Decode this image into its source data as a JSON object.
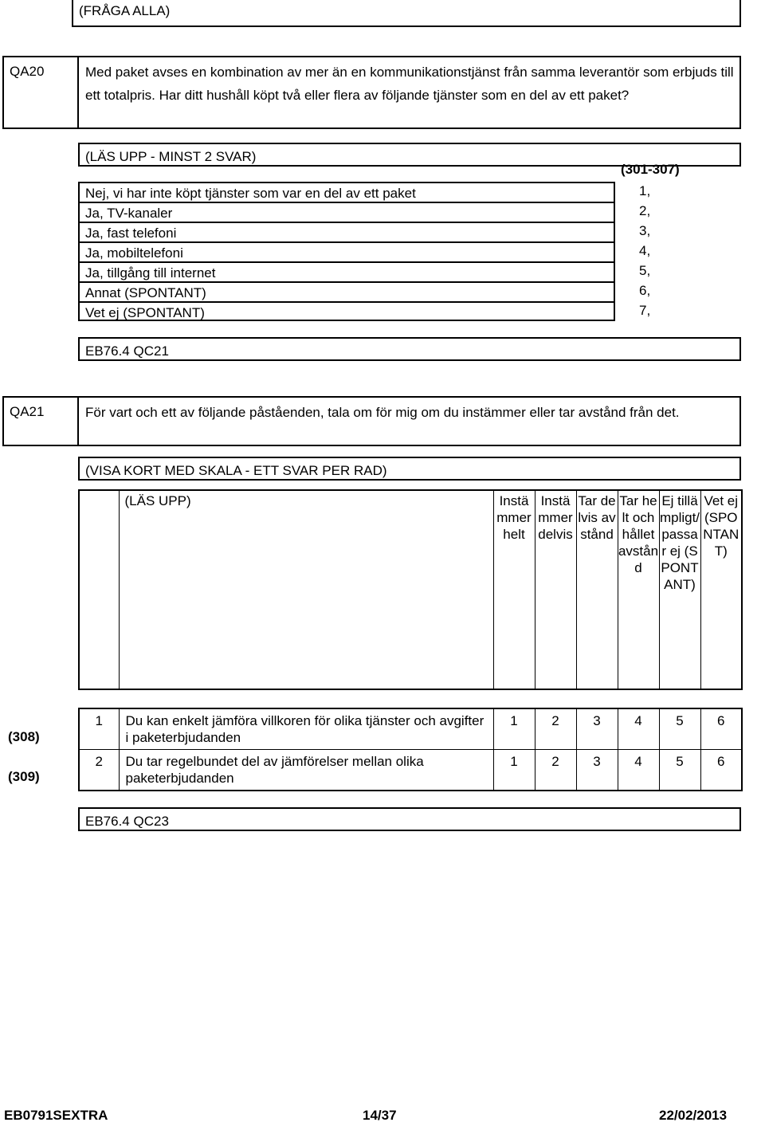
{
  "document": {
    "top_instruction": "(FRÅGA ALLA)"
  },
  "qa20": {
    "label": "QA20",
    "text": "Med paket avses en kombination av mer än en kommunikationstjänst från samma leverantör som erbjuds till ett totalpris. Har ditt hushåll köpt två eller flera av följande tjänster som en del av ett paket?",
    "read_instruction": "(LÄS UPP - MINST 2 SVAR)",
    "code_range": "(301-307)",
    "options": [
      {
        "text": "Nej, vi har inte köpt tjänster som var en del av ett paket",
        "code": "1,"
      },
      {
        "text": "Ja, TV-kanaler",
        "code": "2,"
      },
      {
        "text": "Ja, fast telefoni",
        "code": "3,"
      },
      {
        "text": "Ja, mobiltelefoni",
        "code": "4,"
      },
      {
        "text": "Ja, tillgång till internet",
        "code": "5,"
      },
      {
        "text": "Annat (SPONTANT)",
        "code": "6,"
      },
      {
        "text": "Vet ej (SPONTANT)",
        "code": "7,"
      }
    ],
    "source": "EB76.4 QC21"
  },
  "qa21": {
    "label": "QA21",
    "text": "För vart och ett av följande påståenden, tala om för mig om du instämmer eller tar avstånd från det.",
    "show_card_instruction": "(VISA KORT MED SKALA - ETT SVAR PER RAD)",
    "read_instruction": "(LÄS UPP)",
    "scale_headers": [
      "Instämmer helt",
      "Instämmer delvis",
      "Tar delvis avstånd",
      "Tar helt och hållet avstånd",
      "Ej tillämpligt/ passar ej (SPONTANT)",
      "Vet ej (SPONTANT)"
    ],
    "scale_values": [
      "1",
      "2",
      "3",
      "4",
      "5",
      "6"
    ],
    "statements": [
      {
        "number": "1",
        "side_code": "(308)",
        "text": "Du kan enkelt jämföra villkoren för olika tjänster och avgifter i paketerbjudanden"
      },
      {
        "number": "2",
        "side_code": "(309)",
        "text": "Du tar regelbundet del av jämförelser mellan olika paketerbjudanden"
      }
    ],
    "source": "EB76.4 QC23"
  },
  "footer": {
    "survey_id": "EB0791SEXTRA",
    "page": "14/37",
    "date": "22/02/2013"
  }
}
